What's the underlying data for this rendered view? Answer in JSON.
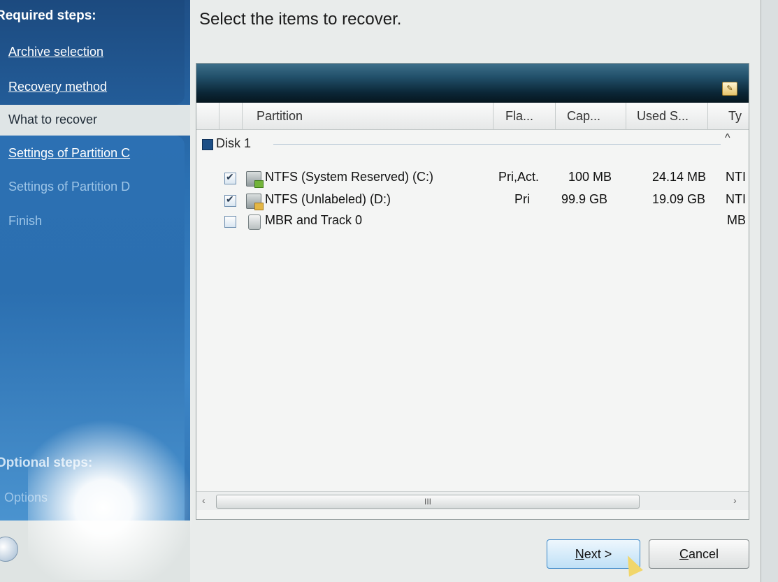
{
  "sidebar": {
    "required_header": "Required steps:",
    "steps": [
      {
        "label": "Archive selection",
        "state": "done"
      },
      {
        "label": "Recovery method",
        "state": "done"
      },
      {
        "label": "What to recover",
        "state": "current"
      },
      {
        "label": "Settings of Partition C",
        "state": "done"
      },
      {
        "label": "Settings of Partition D",
        "state": "pending"
      },
      {
        "label": "Finish",
        "state": "pending"
      }
    ],
    "optional_header": "Optional steps:",
    "optional_steps": [
      {
        "label": "Options"
      }
    ]
  },
  "main": {
    "heading": "Select the items to recover.",
    "columns": [
      "Partition",
      "Fla...",
      "Cap...",
      "Used S...",
      "Ty"
    ],
    "disk_group": "Disk 1",
    "rows": [
      {
        "checked": true,
        "name": "NTFS (System Reserved) (C:)",
        "flags": "Pri,Act.",
        "capacity": "100 MB",
        "used": "24.14 MB",
        "type": "NTI"
      },
      {
        "checked": true,
        "name": "NTFS (Unlabeled) (D:)",
        "flags": "Pri",
        "capacity": "99.9 GB",
        "used": "19.09 GB",
        "type": "NTI"
      },
      {
        "checked": false,
        "name": "MBR and Track 0",
        "flags": "",
        "capacity": "",
        "used": "",
        "type": "MB"
      }
    ],
    "scroll_thumb_label": "III"
  },
  "buttons": {
    "next_mnemonic": "N",
    "next_rest": "ext >",
    "cancel_mnemonic": "C",
    "cancel_rest": "ancel"
  },
  "icons": {
    "panel_icon": "notes-icon",
    "disk_icon": "disk-icon",
    "partition_icon": "partition-icon",
    "mbr_icon": "mbr-icon"
  },
  "colors": {
    "sidebar_blue": "#2a6fb1",
    "panel_header": "#0b2636",
    "next_button": "#bfe0f6"
  }
}
